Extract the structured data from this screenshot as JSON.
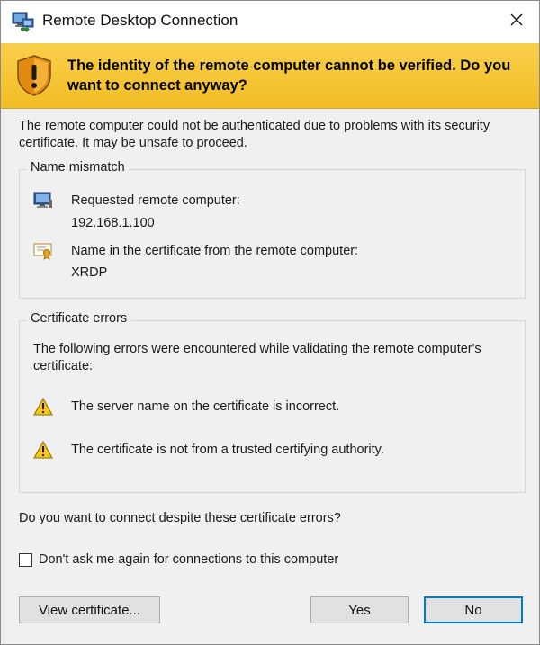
{
  "window": {
    "title": "Remote Desktop Connection",
    "icons": {
      "app": "remote-desktop-icon",
      "close": "close-icon"
    }
  },
  "banner": {
    "icon": "warning-shield-icon",
    "text": "The identity of the remote computer cannot be verified. Do you want to connect anyway?"
  },
  "intro_text": "The remote computer could not be authenticated due to problems with its security certificate. It may be unsafe to proceed.",
  "name_mismatch": {
    "legend": "Name mismatch",
    "requested_label": "Requested remote computer:",
    "requested_value": "192.168.1.100",
    "requested_icon": "computer-icon",
    "cert_label": "Name in the certificate from the remote computer:",
    "cert_value": "XRDP",
    "cert_icon": "certificate-icon"
  },
  "certificate_errors": {
    "legend": "Certificate errors",
    "intro": "The following errors were encountered while validating the remote computer's certificate:",
    "errors": [
      {
        "icon": "warning-icon",
        "text": "The server name on the certificate is incorrect."
      },
      {
        "icon": "warning-icon",
        "text": "The certificate is not from a trusted certifying authority."
      }
    ]
  },
  "question": "Do you want to connect despite these certificate errors?",
  "dont_ask": {
    "label": "Don't ask me again for connections to this computer",
    "checked": false
  },
  "buttons": {
    "view_certificate": "View certificate...",
    "yes": "Yes",
    "no": "No"
  },
  "colors": {
    "banner": "#f7c83a",
    "accent": "#0078d7"
  }
}
